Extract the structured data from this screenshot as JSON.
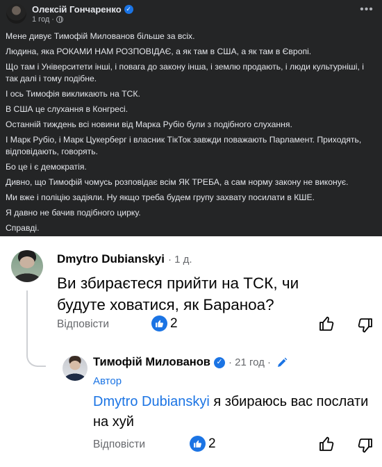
{
  "post": {
    "author": "Олексій Гончаренко",
    "time": "1 год",
    "paragraphs": [
      "Мене дивує Тимофій Милованов більше за всіх.",
      "Людина, яка РОКАМИ НАМ РОЗПОВІДАЄ, а як там в США, а як там в Європі.",
      "Що там і Університети інші, і повага до закону інша, і землю продають, і люди культурніші, і так далі і тому подібне.",
      "І ось Тимофія викликають на ТСК.",
      "В США це слухання в Конгресі.",
      "Останній тиждень всі новини від Марка Рубіо були з подібного слухання.",
      "І Марк Рубіо, і Марк Цукерберг і власник ТікТок завжди поважають Парламент. Приходять, відповідають, говорять.",
      "Бо це і є демократія.",
      "Дивно, що Тимофій чомусь розповідає всім ЯК ТРЕБА, а сам норму закону не виконує.",
      "Ми вже і поліцію задіяли. Ну якщо треба будем групу захвату посилати в КШЕ.",
      "Я давно не бачив подібного цирку.",
      "Справді."
    ]
  },
  "comments": [
    {
      "author": "Dmytro Dubianskyi",
      "time": "· 1 д.",
      "text": "Ви збираєтеся прийти на ТСК, чи будуте ховатися, як Бараноа?",
      "reply_label": "Відповісти",
      "reaction_count": "2"
    },
    {
      "author": "Тимофій Милованов",
      "time": "· 21 год ·",
      "tag": "Автор",
      "mention": "Dmytro Dubianskyi",
      "text": " я збираюсь вас послати на хуй",
      "reply_label": "Відповісти",
      "reaction_count": "2"
    }
  ],
  "colors": {
    "dark_bg": "#242526",
    "accent_blue": "#1b74e4",
    "muted_text": "#65676b"
  },
  "icons": [
    "verified-badge-icon",
    "globe-icon",
    "more-options-icon",
    "like-reaction-icon",
    "thumbs-up-icon",
    "thumbs-down-icon",
    "pencil-icon"
  ]
}
